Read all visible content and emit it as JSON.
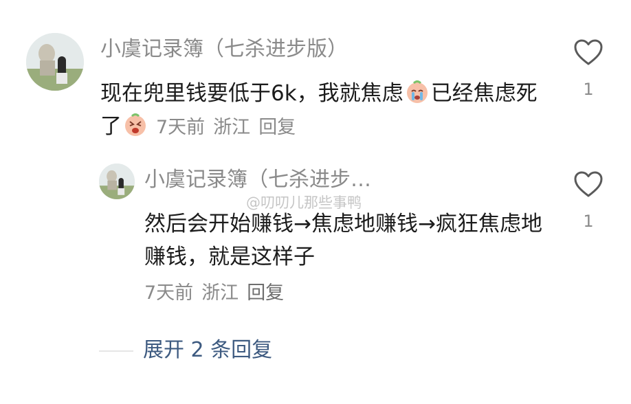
{
  "comment": {
    "username": "小虞记录簿（七杀进步版）",
    "content_part1": "现在兜里钱要低于6k，我就焦虑",
    "content_part2": "已经焦虑死了",
    "emoji1": "crying-emoji",
    "emoji2": "screaming-emoji",
    "time": "7天前",
    "location": "浙江",
    "reply_label": "回复",
    "like_count": "1"
  },
  "reply": {
    "username": "小虞记录簿（七杀进步…",
    "content": "然后会开始赚钱→焦虑地赚钱→疯狂焦虑地赚钱，就是这样子",
    "time": "7天前",
    "location": "浙江",
    "reply_label": "回复",
    "like_count": "1"
  },
  "watermark": "@叨叨儿那些事鸭",
  "expand_label": "展开 2 条回复",
  "colors": {
    "username": "#8a8a8a",
    "content": "#1c1c1c",
    "expand": "#3d5a80"
  }
}
